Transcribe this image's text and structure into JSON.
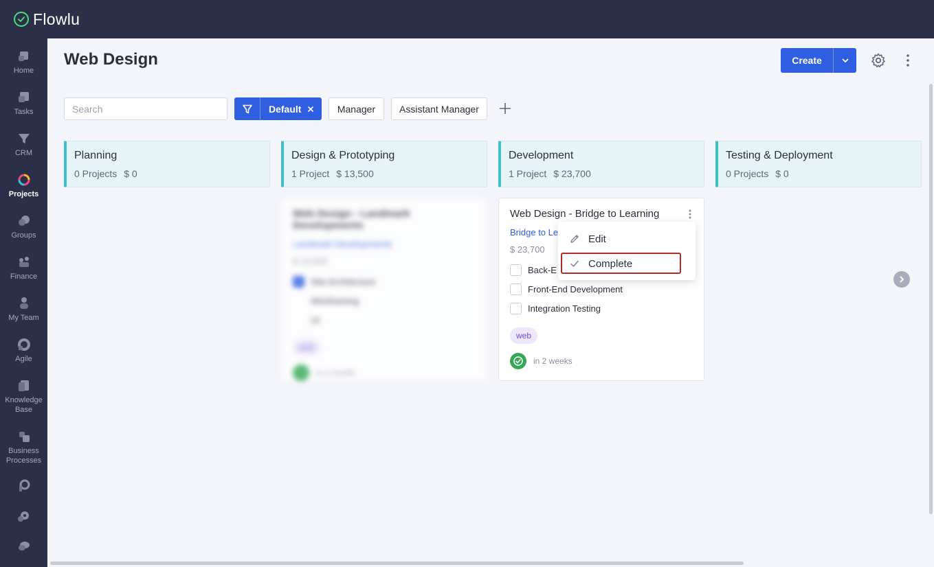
{
  "app": {
    "name": "Flowlu"
  },
  "sidebar": {
    "items": [
      {
        "label": "Home",
        "icon": "home-icon"
      },
      {
        "label": "Tasks",
        "icon": "tasks-icon"
      },
      {
        "label": "CRM",
        "icon": "crm-icon"
      },
      {
        "label": "Projects",
        "icon": "projects-icon",
        "active": true
      },
      {
        "label": "Groups",
        "icon": "groups-icon"
      },
      {
        "label": "Finance",
        "icon": "finance-icon"
      },
      {
        "label": "My Team",
        "icon": "team-icon"
      },
      {
        "label": "Agile",
        "icon": "agile-icon"
      },
      {
        "label": "Knowledge\nBase",
        "icon": "knowledge-base-icon"
      },
      {
        "label": "Business\nProcesses",
        "icon": "business-processes-icon"
      }
    ],
    "bottom_icons": [
      "apps-icon",
      "settings-icon",
      "chat-icon"
    ]
  },
  "header": {
    "title": "Web Design",
    "create_label": "Create"
  },
  "filters": {
    "search_placeholder": "Search",
    "active_filter": "Default",
    "presets": [
      "Manager",
      "Assistant Manager"
    ]
  },
  "columns": [
    {
      "title": "Planning",
      "count": "0 Projects",
      "amount": "$ 0"
    },
    {
      "title": "Design & Prototyping",
      "count": "1 Project",
      "amount": "$ 13,500"
    },
    {
      "title": "Development",
      "count": "1 Project",
      "amount": "$ 23,700"
    },
    {
      "title": "Testing & Deployment",
      "count": "0 Projects",
      "amount": "$ 0"
    }
  ],
  "blurred_card": {
    "title": "Web Design - Landmark Developments",
    "client": "Landmark Developments",
    "amount": "$ 13,500",
    "tasks": [
      "Site Architecture",
      "Wireframing",
      "UI"
    ],
    "tag": "web",
    "due": "in a month"
  },
  "card": {
    "title": "Web Design - Bridge to Learning",
    "client": "Bridge to Le",
    "amount": "$ 23,700",
    "tasks": [
      "Back-E",
      "Front-End Development",
      "Integration Testing"
    ],
    "tag": "web",
    "due": "in 2 weeks"
  },
  "menu": {
    "items": [
      {
        "label": "Edit",
        "icon": "pencil-icon"
      },
      {
        "label": "Complete",
        "icon": "check-icon"
      }
    ]
  },
  "colors": {
    "topbar": "#2c2f48",
    "accent": "#2f5fe0",
    "column_border": "#3bbfcc",
    "highlight": "#b02a2a",
    "success": "#34a853"
  }
}
